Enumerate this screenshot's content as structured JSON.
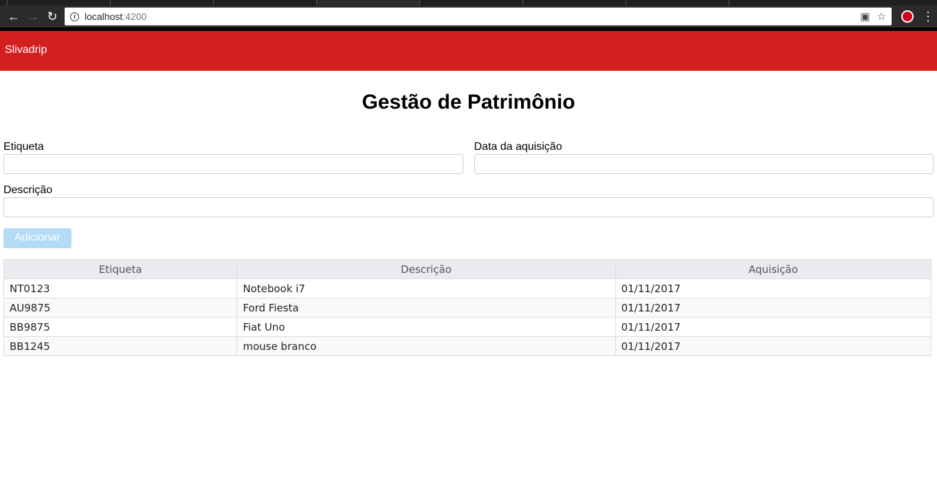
{
  "browser": {
    "url_host": "localhost",
    "url_port": ":4200"
  },
  "app": {
    "brand": "Slivadrip",
    "title": "Gestão de Patrimônio"
  },
  "form": {
    "etiqueta_label": "Etiqueta",
    "data_label": "Data da aquisição",
    "descricao_label": "Descrição",
    "add_label": "Adicionar"
  },
  "table": {
    "headers": [
      "Etiqueta",
      "Descrição",
      "Aquisição"
    ],
    "rows": [
      [
        "NT0123",
        "Notebook i7",
        "01/11/2017"
      ],
      [
        "AU9875",
        "Ford Fiesta",
        "01/11/2017"
      ],
      [
        "BB9875",
        "Fiat Uno",
        "01/11/2017"
      ],
      [
        "BB1245",
        "mouse branco",
        "01/11/2017"
      ]
    ]
  }
}
